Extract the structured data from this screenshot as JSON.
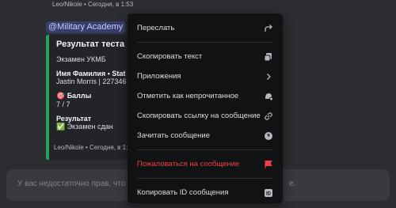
{
  "chat": {
    "top_footer": "Leo/Nikole • Сегодня, в 1:53",
    "mention": "@Military Academy",
    "embed": {
      "title": "Результат теста",
      "subtitle": "Экзамен УКМБ",
      "field1_name": "Имя Фамилия • Stat I",
      "field1_value": "Jastin Morris | 227346",
      "field2_name": "🎯 Баллы",
      "field2_value": "7 / 7",
      "field3_name": "Результат",
      "field3_value": "✅ Экзамен сдан"
    },
    "bottom_footer": "Leo/Nikole • Сегодня, в 1:53"
  },
  "input": {
    "placeholder_left": "У вас недостаточно прав, что",
    "placeholder_right": "е."
  },
  "menu": {
    "items": [
      {
        "label": "Переслать",
        "icon": "forward-icon"
      },
      {
        "label": "Скопировать текст",
        "icon": "copy-icon"
      },
      {
        "label": "Приложения",
        "icon": "chevron-right-icon"
      },
      {
        "label": "Отметить как непрочитанное",
        "icon": "mark-unread-icon"
      },
      {
        "label": "Скопировать ссылку на сообщение",
        "icon": "link-icon"
      },
      {
        "label": "Зачитать сообщение",
        "icon": "speak-icon"
      },
      {
        "label": "Пожаловаться на сообщение",
        "icon": "flag-icon"
      },
      {
        "label": "Копировать ID сообщения",
        "icon": "id-icon"
      }
    ]
  },
  "colors": {
    "danger": "#f23f43",
    "accent": "#23a559",
    "menu_bg": "#111214"
  }
}
